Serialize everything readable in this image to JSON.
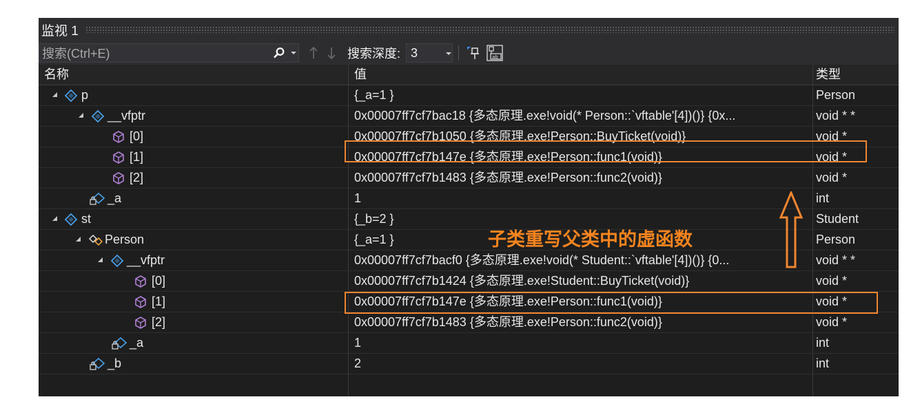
{
  "window": {
    "title": "监视 1"
  },
  "toolbar": {
    "search_placeholder": "搜索(Ctrl+E)",
    "search_depth_label": "搜索深度:",
    "search_depth_value": "3"
  },
  "columns": {
    "name": "名称",
    "value": "值",
    "type": "类型"
  },
  "rows": [
    {
      "name": "p",
      "value": "{_a=1 }",
      "type": "Person"
    },
    {
      "name": "__vfptr",
      "value": "0x00007ff7cf7bac18 {多态原理.exe!void(* Person::`vftable'[4])()} {0x...",
      "type": "void * *"
    },
    {
      "name": "[0]",
      "value": "0x00007ff7cf7b1050 {多态原理.exe!Person::BuyTicket(void)}",
      "type": "void *"
    },
    {
      "name": "[1]",
      "value": "0x00007ff7cf7b147e {多态原理.exe!Person::func1(void)}",
      "type": "void *"
    },
    {
      "name": "[2]",
      "value": "0x00007ff7cf7b1483 {多态原理.exe!Person::func2(void)}",
      "type": "void *"
    },
    {
      "name": "_a",
      "value": "1",
      "type": "int"
    },
    {
      "name": "st",
      "value": "{_b=2 }",
      "type": "Student"
    },
    {
      "name": "Person",
      "value": "{_a=1 }",
      "type": "Person"
    },
    {
      "name": "__vfptr",
      "value": "0x00007ff7cf7bacf0 {多态原理.exe!void(* Student::`vftable'[4])()} {0...",
      "type": "void * *"
    },
    {
      "name": "[0]",
      "value": "0x00007ff7cf7b1424 {多态原理.exe!Student::BuyTicket(void)}",
      "type": "void *"
    },
    {
      "name": "[1]",
      "value": "0x00007ff7cf7b147e {多态原理.exe!Person::func1(void)}",
      "type": "void *"
    },
    {
      "name": "[2]",
      "value": "0x00007ff7cf7b1483 {多态原理.exe!Person::func2(void)}",
      "type": "void *"
    },
    {
      "name": "_a",
      "value": "1",
      "type": "int"
    },
    {
      "name": "_b",
      "value": "2",
      "type": "int"
    }
  ],
  "annotation": {
    "text": "子类重写父类中的虚函数"
  },
  "colors": {
    "highlight": "#f0862f",
    "panel_bg": "#1e1e1e",
    "object_icon": "#4a9ee6",
    "member_icon": "#b180d7"
  }
}
